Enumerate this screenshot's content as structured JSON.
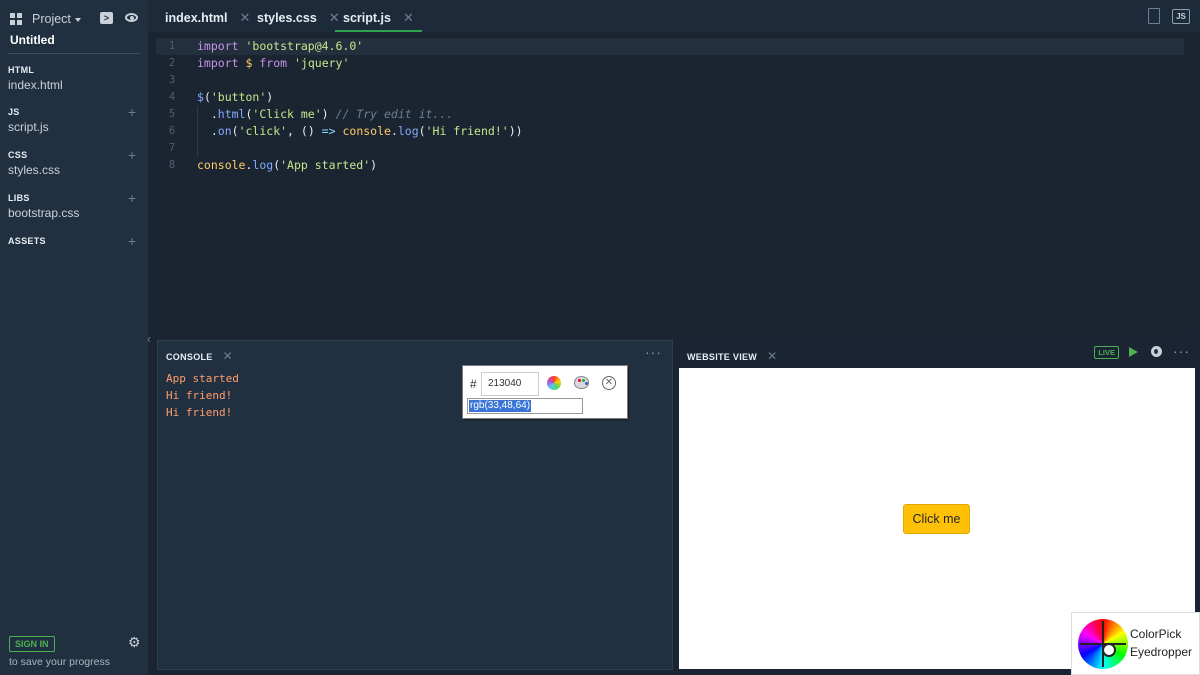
{
  "sidebar": {
    "project_label": "Project",
    "title": "Untitled",
    "sections": [
      {
        "head": "HTML",
        "file": "index.html",
        "addable": false
      },
      {
        "head": "JS",
        "file": "script.js",
        "addable": true
      },
      {
        "head": "CSS",
        "file": "styles.css",
        "addable": true
      },
      {
        "head": "LIBS",
        "file": "bootstrap.css",
        "addable": true
      },
      {
        "head": "ASSETS",
        "file": "",
        "addable": true
      }
    ],
    "signin_label": "SIGN IN",
    "save_text": "to save your progress"
  },
  "tabs": [
    {
      "label": "index.html",
      "active": false
    },
    {
      "label": "styles.css",
      "active": false
    },
    {
      "label": "script.js",
      "active": true
    }
  ],
  "tab_language_badge": "JS",
  "editor": {
    "line_numbers": [
      "1",
      "2",
      "3",
      "4",
      "5",
      "6",
      "7",
      "8"
    ],
    "current_line": 1
  },
  "console": {
    "title": "CONSOLE",
    "logs": [
      "App started",
      "Hi friend!",
      "Hi friend!"
    ]
  },
  "colorpicker": {
    "hash": "#",
    "hex_value": "213040",
    "rgb_value": "rgb(33,48,64)"
  },
  "website_view": {
    "title": "WEBSITE VIEW",
    "live_badge": "LIVE",
    "button_label": "Click me"
  },
  "colorpick_extension": {
    "line1": "ColorPick",
    "line2": "Eyedropper"
  },
  "colors": {
    "sidebar_bg": "#213040",
    "editor_bg": "#1b2531",
    "accent_green": "#4caf50",
    "button_yellow": "#ffc107",
    "console_log": "#ff9e6b"
  }
}
